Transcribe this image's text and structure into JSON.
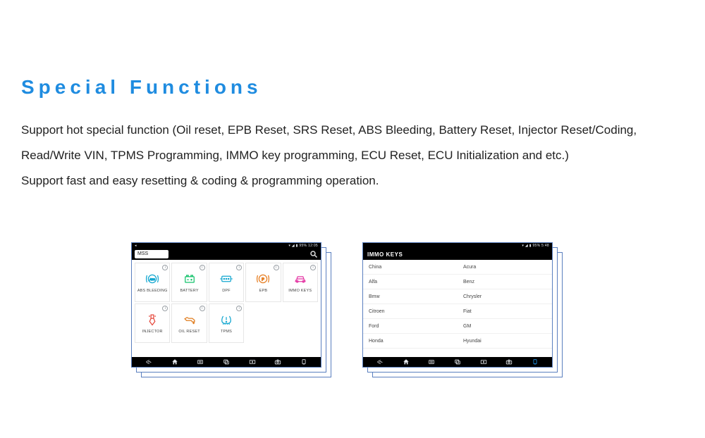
{
  "title": "Special Functions",
  "description": {
    "line1": "Support hot special function (Oil reset, EPB Reset, SRS Reset, ABS Bleeding, Battery Reset, Injector Reset/Coding,",
    "line2": "Read/Write VIN, TPMS Programming, IMMO key programming, ECU Reset, ECU Initialization and etc.)",
    "line3": "Support fast and easy resetting & coding & programming operation."
  },
  "tablet1": {
    "status": {
      "left": "◂",
      "right": "▾ ◢ ▮ 95% 12:05"
    },
    "search_value": "MSS",
    "tiles": [
      {
        "id": "abs",
        "label": "ABS BLEEDING",
        "color": "#13a7d0"
      },
      {
        "id": "battery",
        "label": "BATTERY",
        "color": "#13c26b"
      },
      {
        "id": "dpf",
        "label": "DPF",
        "color": "#13a7d0"
      },
      {
        "id": "epb",
        "label": "EPB",
        "color": "#e67e22"
      },
      {
        "id": "immo",
        "label": "IMMO KEYS",
        "color": "#e53ba6"
      },
      {
        "id": "injector",
        "label": "INJECTOR",
        "color": "#e5473b"
      },
      {
        "id": "oil",
        "label": "OIL RESET",
        "color": "#e07c1e"
      },
      {
        "id": "tpms",
        "label": "TPMS",
        "color": "#13a7d0"
      }
    ]
  },
  "tablet2": {
    "status": {
      "left": "",
      "right": "▾ ◢ ▮ 95% 5:48"
    },
    "title": "IMMO KEYS",
    "brands": [
      [
        "China",
        "Acura"
      ],
      [
        "Alfa",
        "Benz"
      ],
      [
        "Bmw",
        "Chrysler"
      ],
      [
        "Citroen",
        "Fiat"
      ],
      [
        "Ford",
        "GM"
      ],
      [
        "Honda",
        "Hyundai"
      ]
    ]
  },
  "nav_icons": [
    "back",
    "home",
    "menu",
    "recent",
    "screenshot",
    "camera",
    "vci"
  ]
}
